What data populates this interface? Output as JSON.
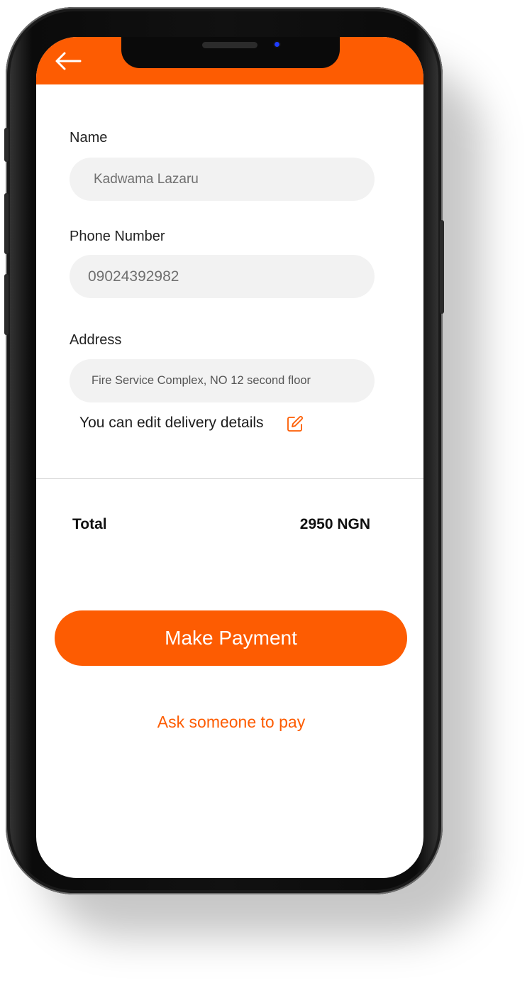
{
  "colors": {
    "accent": "#fd5c02",
    "field_bg": "#f2f2f2",
    "phone_frame": "#111111"
  },
  "header": {
    "back_icon": "arrow-left-icon"
  },
  "form": {
    "name": {
      "label": "Name",
      "value": "Kadwama Lazaru"
    },
    "phone": {
      "label": "Phone Number",
      "value": "09024392982"
    },
    "address": {
      "label": "Address",
      "value": "Fire Service Complex, NO 12 second floor"
    },
    "edit_hint": "You can edit delivery details",
    "edit_icon": "edit-icon"
  },
  "summary": {
    "total_label": "Total",
    "total_value": "2950 NGN"
  },
  "actions": {
    "pay_label": "Make Payment",
    "ask_label": "Ask someone to pay"
  }
}
